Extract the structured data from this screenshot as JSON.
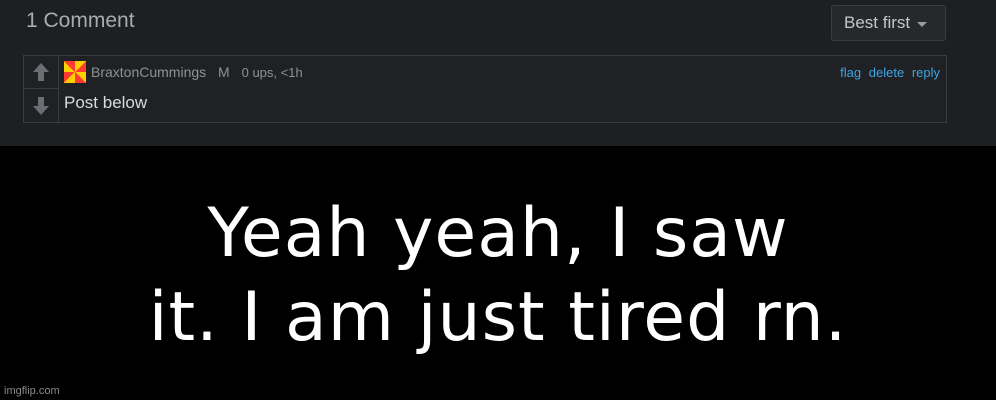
{
  "comments": {
    "count_label": "1 Comment",
    "sort": {
      "selected": "Best first"
    }
  },
  "comment": {
    "username": "BraxtonCummings",
    "gender": "M",
    "meta": "0 ups, <1h",
    "actions": {
      "flag": "flag",
      "delete": "delete",
      "reply": "reply"
    },
    "text": "Post below"
  },
  "meme": {
    "line1": "Yeah yeah, I saw",
    "line2": "it. I am just tired rn."
  },
  "watermark": "imgflip.com",
  "colors": {
    "panel_bg": "#1d1f21",
    "link": "#3fa4e3",
    "meme_bg": "#000000",
    "meme_text": "#ffffff"
  },
  "icons": [
    "caret-down-icon",
    "upvote-arrow-icon",
    "downvote-arrow-icon",
    "avatar"
  ]
}
